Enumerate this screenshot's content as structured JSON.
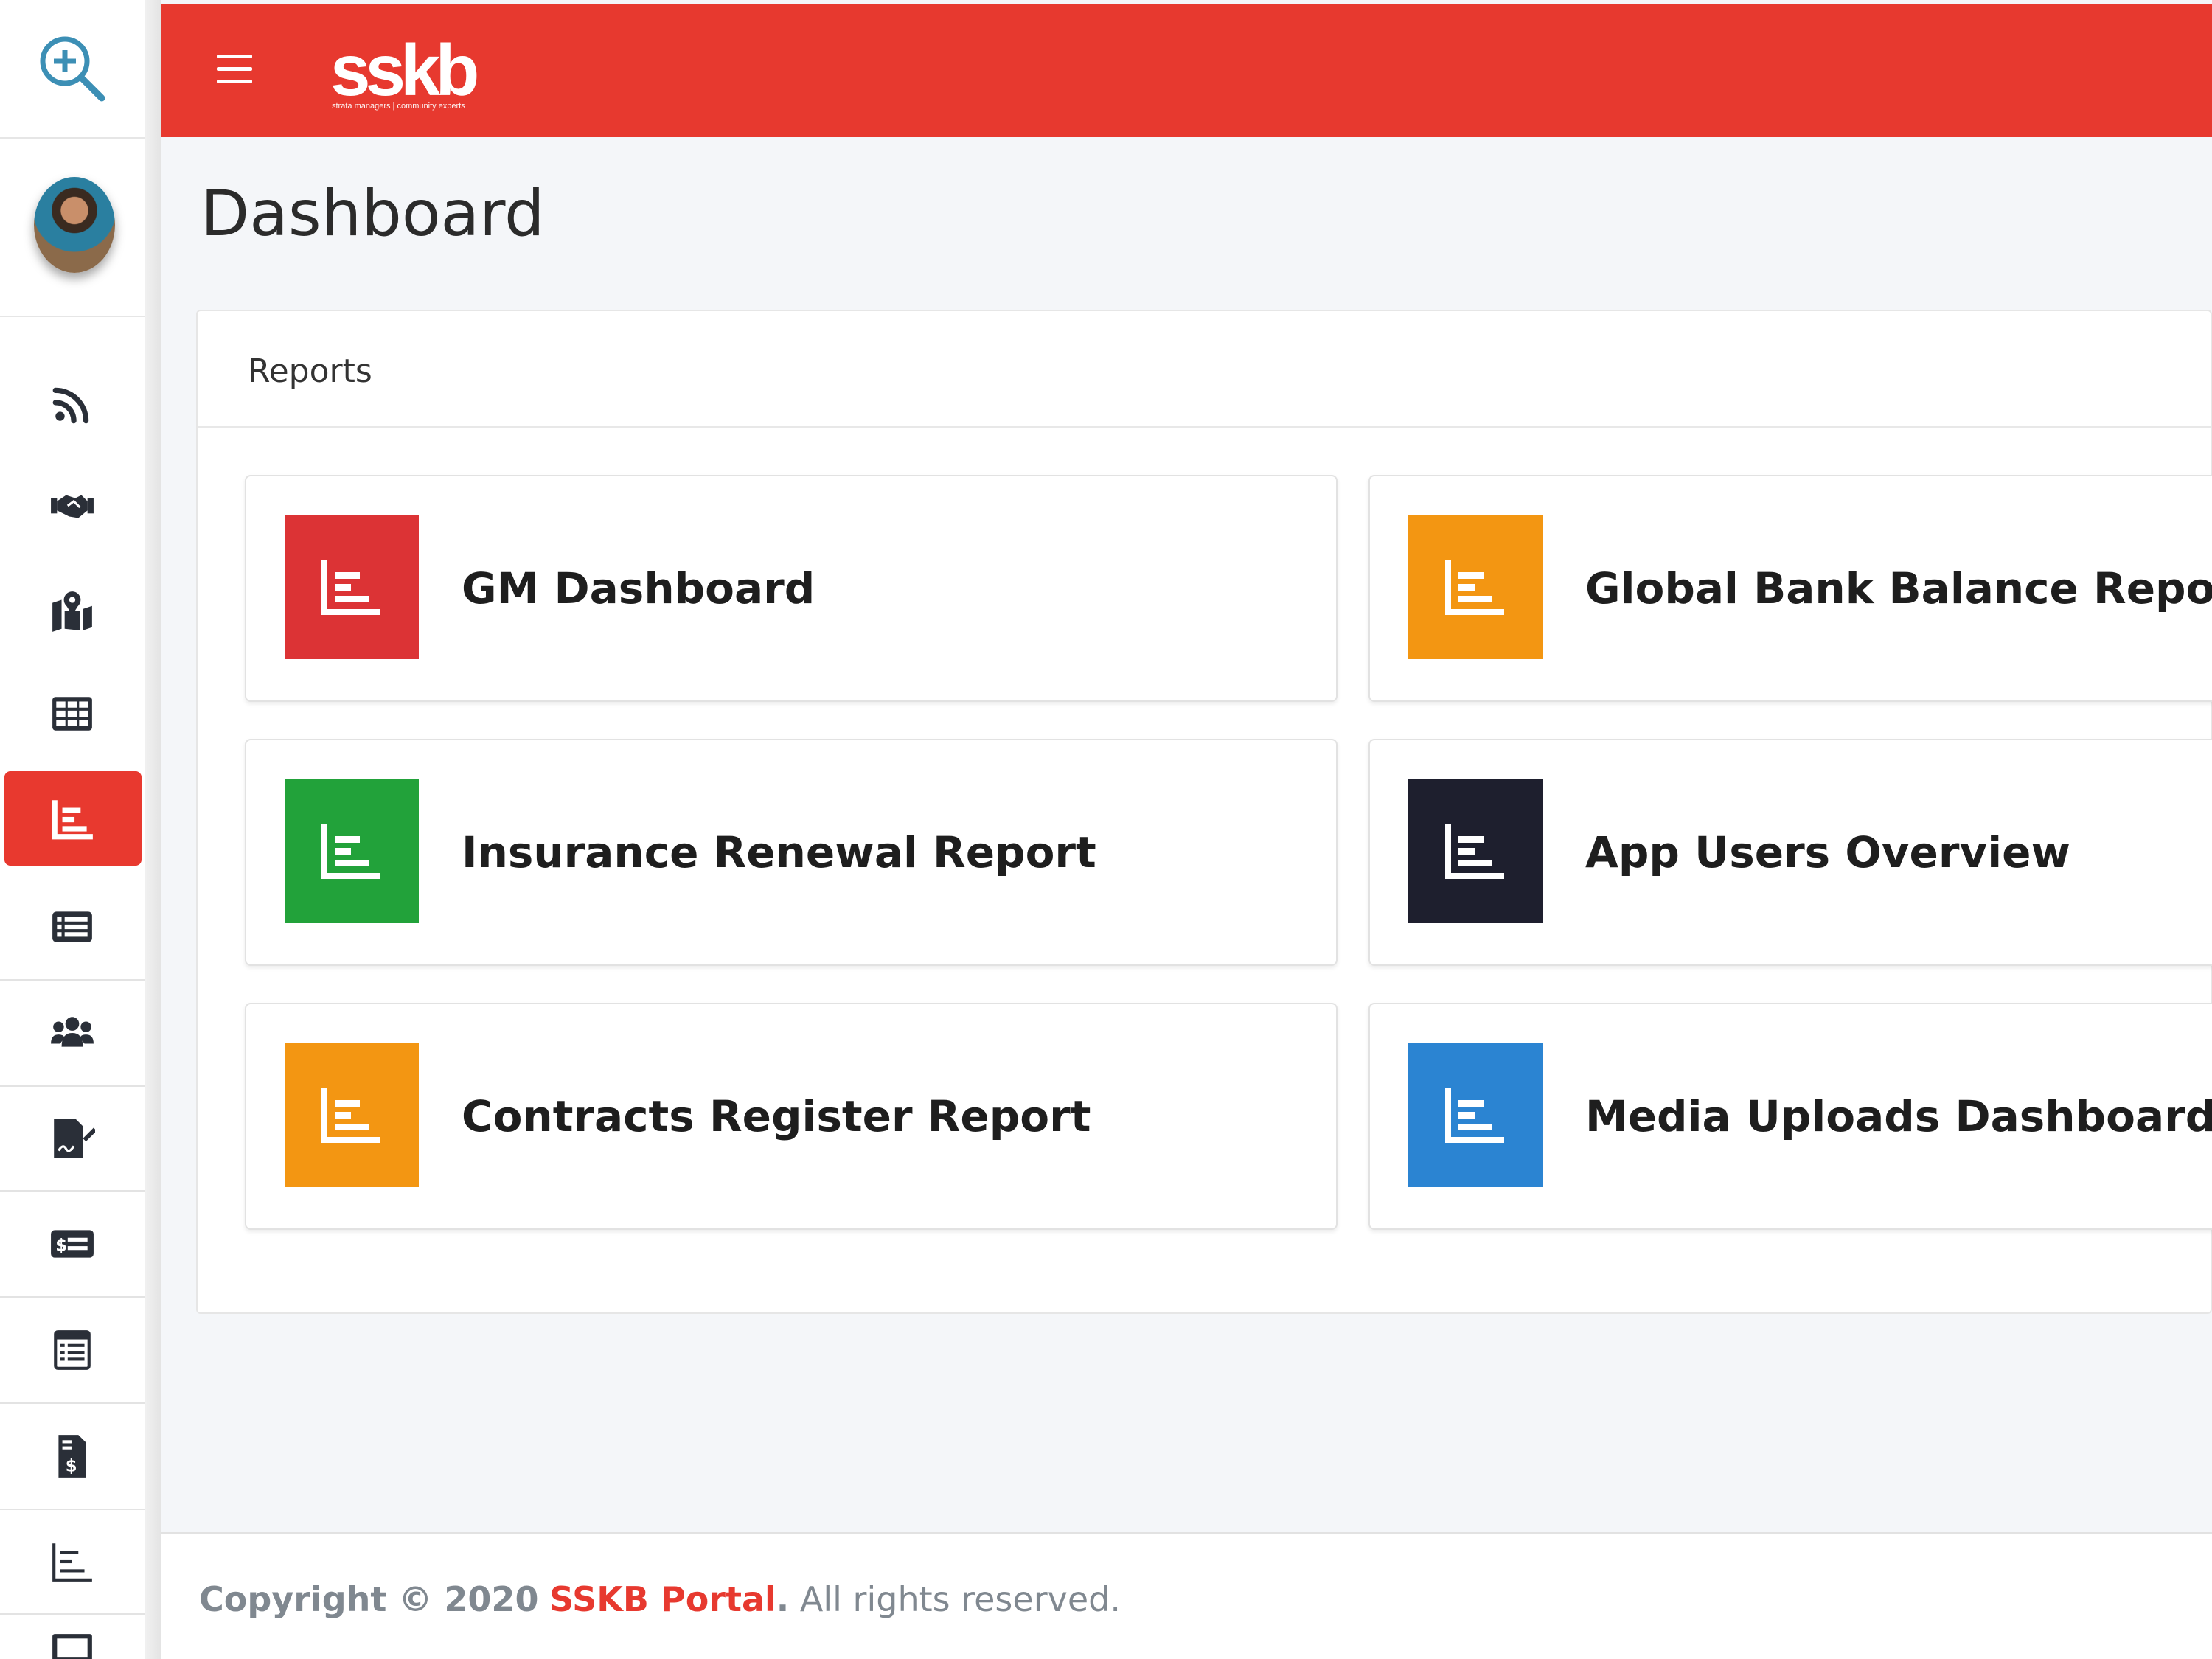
{
  "sidebar": {
    "zoom_icon": "zoom-in-icon",
    "avatar": "user-avatar",
    "items": [
      {
        "icon": "rss-feed-icon",
        "active": false
      },
      {
        "icon": "handshake-icon",
        "active": false
      },
      {
        "icon": "map-location-icon",
        "active": false
      },
      {
        "icon": "table-grid-icon",
        "active": false
      },
      {
        "icon": "chart-bar-icon",
        "active": true
      },
      {
        "icon": "list-icon",
        "active": false
      },
      {
        "icon": "users-icon",
        "active": false
      },
      {
        "icon": "signature-icon",
        "active": false
      },
      {
        "icon": "money-check-icon",
        "active": false
      },
      {
        "icon": "calendar-list-icon",
        "active": false
      },
      {
        "icon": "file-invoice-dollar-icon",
        "active": false
      },
      {
        "icon": "chart-bar-outline-icon",
        "active": false
      },
      {
        "icon": "desktop-icon",
        "active": false
      }
    ]
  },
  "header": {
    "logo_text": "sskb",
    "logo_tagline": "strata managers | community experts",
    "accent": "#e7392f"
  },
  "page": {
    "title": "Dashboard"
  },
  "reports": {
    "title": "Reports",
    "items": [
      {
        "label": "GM Dashboard",
        "color": "#dc3335"
      },
      {
        "label": "Global Bank Balance Report",
        "color": "#f39612"
      },
      {
        "label": "Insurance Renewal Report",
        "color": "#22a23a"
      },
      {
        "label": "App Users Overview",
        "color": "#1e1f2e"
      },
      {
        "label": "Contracts Register Report",
        "color": "#f39612"
      },
      {
        "label": "Media Uploads Dashboard",
        "color": "#2b84d2"
      }
    ]
  },
  "footer": {
    "prefix": "Copyright © 2020",
    "brand": "SSKB Portal",
    "dot": ".",
    "suffix": "All rights reserved."
  }
}
